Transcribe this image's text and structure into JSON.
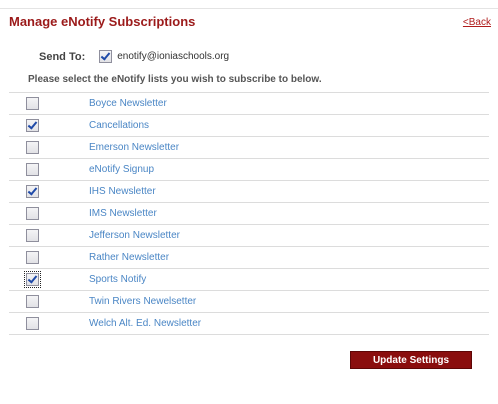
{
  "header": {
    "title": "Manage eNotify Subscriptions",
    "back_link": "<Back"
  },
  "send_to": {
    "label": "Send To:",
    "checked": true,
    "email": "enotify@ioniaschools.org"
  },
  "instructions": "Please select the eNotify lists you wish to subscribe to below.",
  "lists": [
    {
      "name": "Boyce Newsletter",
      "checked": false
    },
    {
      "name": "Cancellations",
      "checked": true
    },
    {
      "name": "Emerson Newsletter",
      "checked": false
    },
    {
      "name": "eNotify Signup",
      "checked": false
    },
    {
      "name": "IHS Newsletter",
      "checked": true
    },
    {
      "name": "IMS Newsletter",
      "checked": false
    },
    {
      "name": "Jefferson Newsletter",
      "checked": false
    },
    {
      "name": "Rather Newsletter",
      "checked": false
    },
    {
      "name": "Sports Notify",
      "checked": true,
      "focused": true
    },
    {
      "name": "Twin Rivers Newelsetter",
      "checked": false
    },
    {
      "name": "Welch Alt. Ed. Newsletter",
      "checked": false
    }
  ],
  "actions": {
    "update_label": "Update Settings"
  },
  "colors": {
    "title": "#9b1a1a",
    "link": "#4a86c5",
    "button_bg": "#8a0e0e"
  }
}
